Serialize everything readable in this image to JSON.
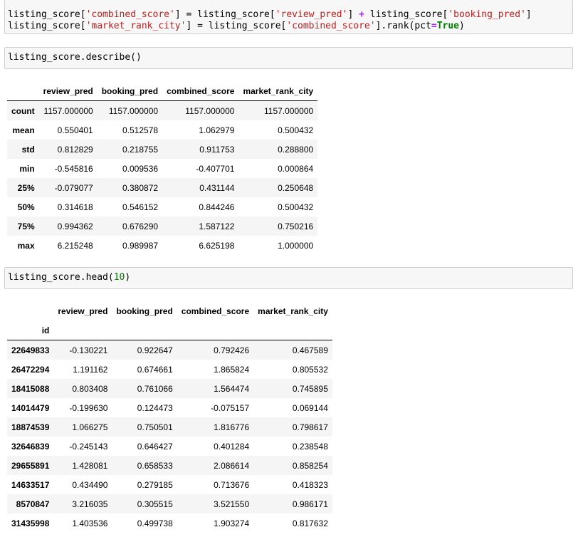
{
  "cell1": {
    "line1": [
      {
        "t": "listing_score[",
        "c": ""
      },
      {
        "t": "'combined_score'",
        "c": "str"
      },
      {
        "t": "] = listing_score[",
        "c": ""
      },
      {
        "t": "'review_pred'",
        "c": "str"
      },
      {
        "t": "] ",
        "c": ""
      },
      {
        "t": "+",
        "c": "op"
      },
      {
        "t": " listing_score[",
        "c": ""
      },
      {
        "t": "'booking_pred'",
        "c": "str"
      },
      {
        "t": "]",
        "c": ""
      }
    ],
    "line2": [
      {
        "t": "listing_score[",
        "c": ""
      },
      {
        "t": "'market_rank_city'",
        "c": "str"
      },
      {
        "t": "] ",
        "c": ""
      },
      {
        "t": "=",
        "c": ""
      },
      {
        "t": " listing_score[",
        "c": ""
      },
      {
        "t": "'combined_score'",
        "c": "str"
      },
      {
        "t": "].rank(pct",
        "c": ""
      },
      {
        "t": "=",
        "c": "op"
      },
      {
        "t": "True",
        "c": "kw"
      },
      {
        "t": ")",
        "c": ""
      }
    ]
  },
  "cell2": {
    "code": [
      {
        "t": "listing_score.describe()",
        "c": ""
      }
    ]
  },
  "describe": {
    "columns": [
      "review_pred",
      "booking_pred",
      "combined_score",
      "market_rank_city"
    ],
    "rows": [
      {
        "label": "count",
        "values": [
          "1157.000000",
          "1157.000000",
          "1157.000000",
          "1157.000000"
        ]
      },
      {
        "label": "mean",
        "values": [
          "0.550401",
          "0.512578",
          "1.062979",
          "0.500432"
        ]
      },
      {
        "label": "std",
        "values": [
          "0.812829",
          "0.218755",
          "0.911753",
          "0.288800"
        ]
      },
      {
        "label": "min",
        "values": [
          "-0.545816",
          "0.009536",
          "-0.407701",
          "0.000864"
        ]
      },
      {
        "label": "25%",
        "values": [
          "-0.079077",
          "0.380872",
          "0.431144",
          "0.250648"
        ]
      },
      {
        "label": "50%",
        "values": [
          "0.314618",
          "0.546152",
          "0.844246",
          "0.500432"
        ]
      },
      {
        "label": "75%",
        "values": [
          "0.994362",
          "0.676290",
          "1.587122",
          "0.750216"
        ]
      },
      {
        "label": "max",
        "values": [
          "6.215248",
          "0.989987",
          "6.625198",
          "1.000000"
        ]
      }
    ]
  },
  "cell3": {
    "code": [
      {
        "t": "listing_score.head(",
        "c": ""
      },
      {
        "t": "10",
        "c": "num"
      },
      {
        "t": ")",
        "c": ""
      }
    ]
  },
  "head": {
    "index_name": "id",
    "columns": [
      "review_pred",
      "booking_pred",
      "combined_score",
      "market_rank_city"
    ],
    "rows": [
      {
        "label": "22649833",
        "values": [
          "-0.130221",
          "0.922647",
          "0.792426",
          "0.467589"
        ]
      },
      {
        "label": "26472294",
        "values": [
          "1.191162",
          "0.674661",
          "1.865824",
          "0.805532"
        ]
      },
      {
        "label": "18415088",
        "values": [
          "0.803408",
          "0.761066",
          "1.564474",
          "0.745895"
        ]
      },
      {
        "label": "14014479",
        "values": [
          "-0.199630",
          "0.124473",
          "-0.075157",
          "0.069144"
        ]
      },
      {
        "label": "18874539",
        "values": [
          "1.066275",
          "0.750501",
          "1.816776",
          "0.798617"
        ]
      },
      {
        "label": "32646839",
        "values": [
          "-0.245143",
          "0.646427",
          "0.401284",
          "0.238548"
        ]
      },
      {
        "label": "29655891",
        "values": [
          "1.428081",
          "0.658533",
          "2.086614",
          "0.858254"
        ]
      },
      {
        "label": "14633517",
        "values": [
          "0.434490",
          "0.279185",
          "0.713676",
          "0.418323"
        ]
      },
      {
        "label": "8570847",
        "values": [
          "3.216035",
          "0.305515",
          "3.521550",
          "0.986171"
        ]
      },
      {
        "label": "31435998",
        "values": [
          "1.403536",
          "0.499738",
          "1.903274",
          "0.817632"
        ]
      }
    ]
  },
  "colors": {
    "string": "#ba2121",
    "keyword": "#008000",
    "operator": "#aa22ff",
    "number": "#008000",
    "striped_row": "#f5f5f5",
    "cell_background": "#f7f7f7"
  }
}
